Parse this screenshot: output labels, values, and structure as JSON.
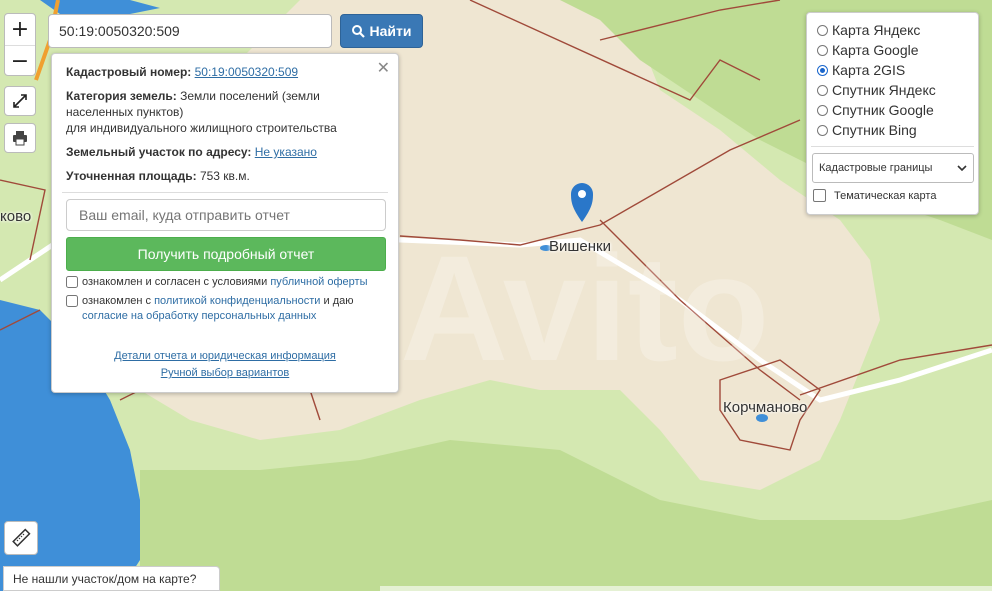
{
  "search": {
    "value": "50:19:0050320:509",
    "button_label": "Найти"
  },
  "zoom": {
    "in_label": "+",
    "out_label": "−"
  },
  "panel": {
    "cadastral_label": "Кадастровый номер:",
    "cadastral_value": "50:19:0050320:509",
    "category_label": "Категория земель:",
    "category_value": "Земли поселений (земли населенных пунктов)",
    "category_use": "для индивидуального жилищного строительства",
    "address_label": "Земельный участок по адресу:",
    "address_value": "Не указано",
    "area_label": "Уточненная площадь:",
    "area_value": "753 кв.м.",
    "email_placeholder": "Ваш email, куда отправить отчет",
    "report_button": "Получить подробный отчет",
    "check1_prefix": "ознакомлен и согласен с условиями ",
    "check1_link": "публичной оферты",
    "check2_prefix": "ознакомлен с ",
    "check2_link1": "политикой конфиденциальности",
    "check2_mid": " и даю ",
    "check2_link2": "согласие на обработку персональных данных",
    "details_link": "Детали отчета и юридическая информация",
    "manual_link": "Ручной выбор вариантов"
  },
  "layers": {
    "options": [
      "Карта Яндекс",
      "Карта Google",
      "Карта 2GIS",
      "Спутник Яндекс",
      "Спутник Google",
      "Спутник Bing"
    ],
    "selected": "Карта 2GIS",
    "overlay_select": "Кадастровые границы",
    "thematic_label": "Тематическая карта"
  },
  "map_labels": {
    "village1": "Вишенки",
    "village2": "Корчманово",
    "village_left": "ково"
  },
  "watermark": "Avito",
  "not_found": "Не нашли участок/дом на карте?",
  "colors": {
    "water": "#3f8fd8",
    "forest": "#bfdc94",
    "settlement": "#efe6d2",
    "boundary": "#a04a3a",
    "pin": "#2a77c9",
    "report_button": "#5cb85c",
    "search_button": "#3a78b5"
  }
}
